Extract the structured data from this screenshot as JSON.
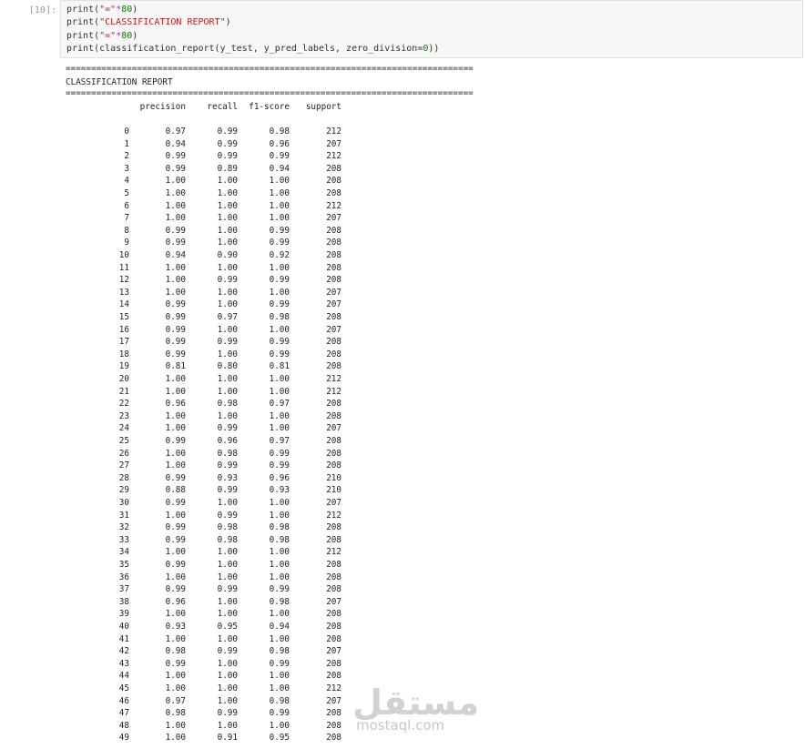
{
  "cell": {
    "prompt": "[10]:",
    "code": [
      {
        "pre": "print(",
        "str": "\"=\"",
        "op": "*",
        "num": "80",
        "post": ")"
      },
      {
        "pre": "print(",
        "str": "\"CLASSIFICATION REPORT\"",
        "op": "",
        "num": "",
        "post": ")"
      },
      {
        "pre": "print(",
        "str": "\"=\"",
        "op": "*",
        "num": "80",
        "post": ")"
      },
      {
        "pre": "print(classification_report(y_test, y_pred_labels, zero_division=",
        "str": "",
        "op": "",
        "num": "0",
        "post": "))"
      }
    ]
  },
  "output": {
    "separator": "================================================================================",
    "title": "CLASSIFICATION REPORT",
    "headers": {
      "precision": "precision",
      "recall": "recall",
      "f1": "f1-score",
      "support": "support"
    },
    "rows": [
      [
        "0",
        "0.97",
        "0.99",
        "0.98",
        "212"
      ],
      [
        "1",
        "0.94",
        "0.99",
        "0.96",
        "207"
      ],
      [
        "2",
        "0.99",
        "0.99",
        "0.99",
        "212"
      ],
      [
        "3",
        "0.99",
        "0.89",
        "0.94",
        "208"
      ],
      [
        "4",
        "1.00",
        "1.00",
        "1.00",
        "208"
      ],
      [
        "5",
        "1.00",
        "1.00",
        "1.00",
        "208"
      ],
      [
        "6",
        "1.00",
        "1.00",
        "1.00",
        "212"
      ],
      [
        "7",
        "1.00",
        "1.00",
        "1.00",
        "207"
      ],
      [
        "8",
        "0.99",
        "1.00",
        "0.99",
        "208"
      ],
      [
        "9",
        "0.99",
        "1.00",
        "0.99",
        "208"
      ],
      [
        "10",
        "0.94",
        "0.90",
        "0.92",
        "208"
      ],
      [
        "11",
        "1.00",
        "1.00",
        "1.00",
        "208"
      ],
      [
        "12",
        "1.00",
        "0.99",
        "0.99",
        "208"
      ],
      [
        "13",
        "1.00",
        "1.00",
        "1.00",
        "207"
      ],
      [
        "14",
        "0.99",
        "1.00",
        "0.99",
        "207"
      ],
      [
        "15",
        "0.99",
        "0.97",
        "0.98",
        "208"
      ],
      [
        "16",
        "0.99",
        "1.00",
        "1.00",
        "207"
      ],
      [
        "17",
        "0.99",
        "0.99",
        "0.99",
        "208"
      ],
      [
        "18",
        "0.99",
        "1.00",
        "0.99",
        "208"
      ],
      [
        "19",
        "0.81",
        "0.80",
        "0.81",
        "208"
      ],
      [
        "20",
        "1.00",
        "1.00",
        "1.00",
        "212"
      ],
      [
        "21",
        "1.00",
        "1.00",
        "1.00",
        "212"
      ],
      [
        "22",
        "0.96",
        "0.98",
        "0.97",
        "208"
      ],
      [
        "23",
        "1.00",
        "1.00",
        "1.00",
        "208"
      ],
      [
        "24",
        "1.00",
        "0.99",
        "1.00",
        "207"
      ],
      [
        "25",
        "0.99",
        "0.96",
        "0.97",
        "208"
      ],
      [
        "26",
        "1.00",
        "0.98",
        "0.99",
        "208"
      ],
      [
        "27",
        "1.00",
        "0.99",
        "0.99",
        "208"
      ],
      [
        "28",
        "0.99",
        "0.93",
        "0.96",
        "210"
      ],
      [
        "29",
        "0.88",
        "0.99",
        "0.93",
        "210"
      ],
      [
        "30",
        "0.99",
        "1.00",
        "1.00",
        "207"
      ],
      [
        "31",
        "1.00",
        "0.99",
        "1.00",
        "212"
      ],
      [
        "32",
        "0.99",
        "0.98",
        "0.98",
        "208"
      ],
      [
        "33",
        "0.99",
        "0.98",
        "0.98",
        "208"
      ],
      [
        "34",
        "1.00",
        "1.00",
        "1.00",
        "212"
      ],
      [
        "35",
        "0.99",
        "1.00",
        "1.00",
        "208"
      ],
      [
        "36",
        "1.00",
        "1.00",
        "1.00",
        "208"
      ],
      [
        "37",
        "0.99",
        "0.99",
        "0.99",
        "208"
      ],
      [
        "38",
        "0.96",
        "1.00",
        "0.98",
        "207"
      ],
      [
        "39",
        "1.00",
        "1.00",
        "1.00",
        "208"
      ],
      [
        "40",
        "0.93",
        "0.95",
        "0.94",
        "208"
      ],
      [
        "41",
        "1.00",
        "1.00",
        "1.00",
        "208"
      ],
      [
        "42",
        "0.98",
        "0.99",
        "0.98",
        "207"
      ],
      [
        "43",
        "0.99",
        "1.00",
        "0.99",
        "208"
      ],
      [
        "44",
        "1.00",
        "1.00",
        "1.00",
        "208"
      ],
      [
        "45",
        "1.00",
        "1.00",
        "1.00",
        "212"
      ],
      [
        "46",
        "0.97",
        "1.00",
        "0.98",
        "207"
      ],
      [
        "47",
        "0.98",
        "0.99",
        "0.99",
        "208"
      ],
      [
        "48",
        "1.00",
        "1.00",
        "1.00",
        "208"
      ],
      [
        "49",
        "1.00",
        "0.91",
        "0.95",
        "208"
      ]
    ]
  },
  "watermark": {
    "arabic": "مستقل",
    "latin": "mostaql.com"
  }
}
